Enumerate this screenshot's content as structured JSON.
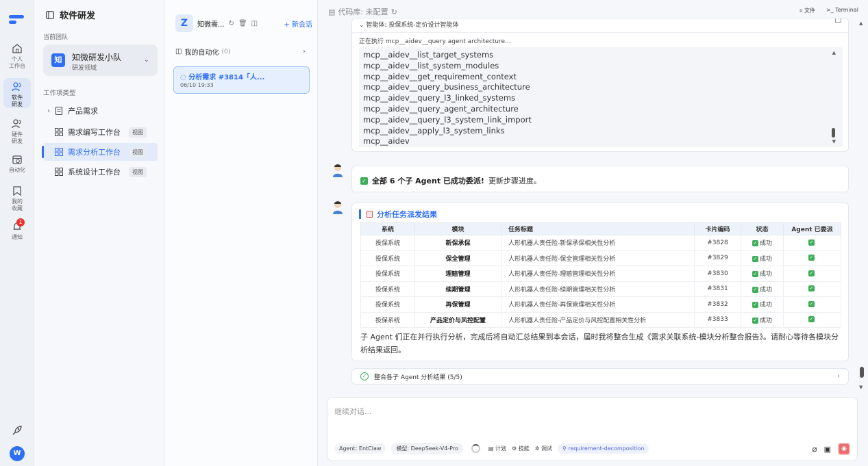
{
  "rail": {
    "items": [
      {
        "label": "个人\n工作台",
        "l1": "个人",
        "l2": "工作台"
      },
      {
        "label": "软件\n研发",
        "l1": "软件",
        "l2": "研发"
      },
      {
        "label": "硬件\n研发",
        "l1": "硬件",
        "l2": "研发"
      },
      {
        "label": "自动化",
        "l1": "自动化",
        "l2": ""
      },
      {
        "label": "我的\n收藏",
        "l1": "我的",
        "l2": "收藏"
      },
      {
        "label": "通知",
        "l1": "通知",
        "l2": ""
      }
    ],
    "notify_badge": "1",
    "avatar_letter": "W"
  },
  "sidebar": {
    "title": "软件研发",
    "team_label": "当前团队",
    "team": {
      "avatar": "知",
      "name": "知微研发小队",
      "domain": "研发领域"
    },
    "types_label": "工作项类型",
    "items": [
      {
        "label": "产品需求",
        "tag": ""
      },
      {
        "label": "需求编写工作台",
        "tag": "视图"
      },
      {
        "label": "需求分析工作台",
        "tag": "视图"
      },
      {
        "label": "系统设计工作台",
        "tag": "视图"
      }
    ]
  },
  "sessions": {
    "logo": "Z",
    "name": "知微需...",
    "new_label": "+ 新会话",
    "automation_label": "我的自动化",
    "automation_count": "(0)",
    "card_title": "分析需求 #3814「人...",
    "card_date": "06/10 19:33"
  },
  "main": {
    "repo_label": "代码库: 未配置",
    "files_label": "文件",
    "terminal_label": "Terminal",
    "tool": {
      "agent": "智能体: 投保系统-定价设计智能体",
      "exec": "正在执行 mcp__aidev__query agent architecture...",
      "lines": [
        "mcp__aidev__list_target_systems",
        "mcp__aidev__list_system_modules",
        "mcp__aidev__get_requirement_context",
        "mcp__aidev__query_business_architecture",
        "mcp__aidev__query_l3_linked_systems",
        "mcp__aidev__query_agent_architecture",
        "mcp__aidev__query_l3_system_link_import",
        "mcp__aidev__apply_l3_system_links",
        "mcp__aidev"
      ]
    },
    "msg1": {
      "bold": "全部 6 个子 Agent 已成功委派!",
      "rest": "更新步骤进度。"
    },
    "result": {
      "title": "分析任务派发结果",
      "headers": [
        "系统",
        "模块",
        "任务标题",
        "卡片编码",
        "状态",
        "Agent 已委派"
      ],
      "rows": [
        {
          "system": "投保系统",
          "module": "新保承保",
          "task": "人形机器人责任险-新保承保相关性分析",
          "code": "#3828",
          "status": "成功"
        },
        {
          "system": "投保系统",
          "module": "保全管理",
          "task": "人形机器人责任险-保全管理相关性分析",
          "code": "#3829",
          "status": "成功"
        },
        {
          "system": "投保系统",
          "module": "理赔管理",
          "task": "人形机器人责任险-理赔管理相关性分析",
          "code": "#3830",
          "status": "成功"
        },
        {
          "system": "投保系统",
          "module": "续期管理",
          "task": "人形机器人责任险-续期管理相关性分析",
          "code": "#3831",
          "status": "成功"
        },
        {
          "system": "投保系统",
          "module": "再保管理",
          "task": "人形机器人责任险-再保管理相关性分析",
          "code": "#3832",
          "status": "成功"
        },
        {
          "system": "投保系统",
          "module": "产品定价与风控配置",
          "task": "人形机器人责任险-产品定价与风控配置相关性分析",
          "code": "#3833",
          "status": "成功"
        }
      ],
      "footer": "子 Agent 们正在并行执行分析，完成后将自动汇总结果到本会话，届时我将整合生成《需求关联系统-模块分析整合报告》。请耐心等待各模块分析结果返回。"
    },
    "step": "整合各子 Agent 分析结果 (5/5)",
    "composer": {
      "placeholder": "继续对话...",
      "agent": "Agent: EntClaw",
      "model": "模型: DeepSeek-V4-Pro",
      "plan": "计划",
      "skill": "技能",
      "debug": "调试",
      "skill_tag": "requirement-decomposition"
    }
  }
}
